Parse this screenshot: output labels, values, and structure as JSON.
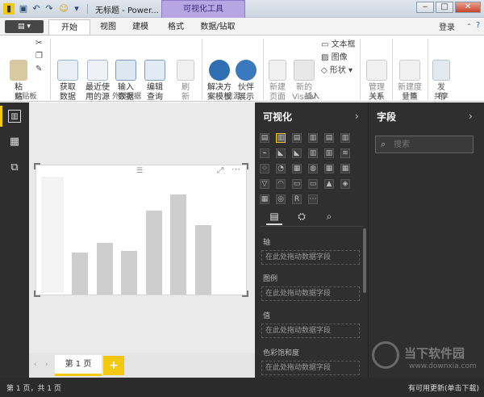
{
  "window": {
    "title": "无标题 - Power...",
    "context_tab": "可视化工具",
    "signin": "登录"
  },
  "tabs": [
    "开始",
    "视图",
    "建模",
    "格式",
    "数据/钻取"
  ],
  "ribbon": {
    "clipboard": {
      "paste": "粘\n贴",
      "group": "剪贴板"
    },
    "external": {
      "get_data": "获取\n数据",
      "recent": "最近使\n用的源",
      "input": "输入\n数据",
      "edit": "编辑\n查询",
      "refresh": "刷\n新",
      "group": "外部数据"
    },
    "resources": {
      "solution": "解决方\n案模板",
      "partner": "伙伴\n展示",
      "group": "资源"
    },
    "insert": {
      "newpage": "新建\n页面",
      "newvisual": "新的\nVisual",
      "textbox": "文本框",
      "image": "图像",
      "shape": "形状",
      "group": "插入"
    },
    "relations": {
      "manage": "管理\n关系",
      "group": "关系"
    },
    "calc": {
      "newmeasure": "新建度\n量值",
      "group": "计算"
    },
    "share": {
      "publish": "发\n布",
      "group": "共享"
    }
  },
  "viz": {
    "title": "可视化",
    "wells": [
      {
        "label": "轴",
        "placeholder": "在此处拖动数据字段"
      },
      {
        "label": "图例",
        "placeholder": "在此处拖动数据字段"
      },
      {
        "label": "值",
        "placeholder": "在此处拖动数据字段"
      },
      {
        "label": "色彩饱和度",
        "placeholder": "在此处拖动数据字段"
      }
    ]
  },
  "fields": {
    "title": "字段",
    "search_placeholder": "搜索"
  },
  "pages": {
    "page1": "第 1 页",
    "add": "+"
  },
  "status": {
    "left": "第 1 页，共 1 页",
    "right": "有可用更新(单击下载)"
  },
  "chart_data": {
    "type": "bar",
    "values": [
      2.6,
      3.2,
      2.7,
      5.2,
      6.2,
      4.3
    ],
    "ylim": [
      0,
      7
    ]
  },
  "watermark": {
    "name": "当下软件园",
    "url": "www.downxia.com"
  }
}
